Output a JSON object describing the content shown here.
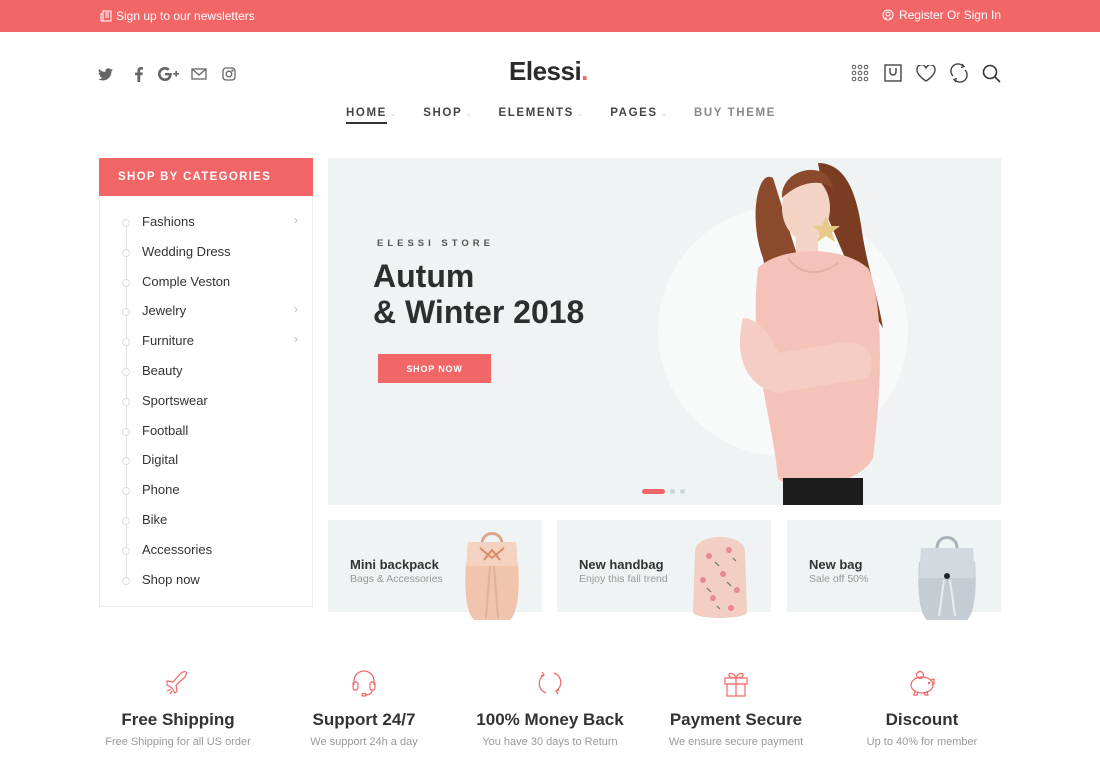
{
  "topbar": {
    "newsletter": "Sign up to our newsletters",
    "account": "Register Or Sign In"
  },
  "brand": {
    "name": "Elessi",
    "dot": ".",
    "accent": "#f26667"
  },
  "social": [
    "twitter-icon",
    "facebook-icon",
    "google-plus-icon",
    "mail-icon",
    "instagram-icon"
  ],
  "tools": [
    "grid-menu-icon",
    "shopping-bag-icon",
    "heart-icon",
    "compare-icon",
    "search-icon"
  ],
  "nav": [
    {
      "label": "HOME",
      "has_dropdown": true,
      "active": true
    },
    {
      "label": "SHOP",
      "has_dropdown": true
    },
    {
      "label": "ELEMENTS",
      "has_dropdown": true
    },
    {
      "label": "PAGES",
      "has_dropdown": true
    },
    {
      "label": "BUY THEME",
      "has_dropdown": false
    }
  ],
  "categories": {
    "heading": "SHOP BY CATEGORIES",
    "items": [
      {
        "label": "Fashions",
        "has_sub": true
      },
      {
        "label": "Wedding Dress",
        "has_sub": false
      },
      {
        "label": "Comple Veston",
        "has_sub": false
      },
      {
        "label": "Jewelry",
        "has_sub": true
      },
      {
        "label": "Furniture",
        "has_sub": true
      },
      {
        "label": "Beauty",
        "has_sub": false
      },
      {
        "label": "Sportswear",
        "has_sub": false
      },
      {
        "label": "Football",
        "has_sub": false
      },
      {
        "label": "Digital",
        "has_sub": false
      },
      {
        "label": "Phone",
        "has_sub": false
      },
      {
        "label": "Bike",
        "has_sub": false
      },
      {
        "label": "Accessories",
        "has_sub": false
      },
      {
        "label": "Shop now",
        "has_sub": false
      }
    ]
  },
  "hero": {
    "eyebrow": "ELESSI STORE",
    "title_line1": "Autum",
    "title_line2": "& Winter 2018",
    "cta": "SHOP NOW",
    "slides_total": 3,
    "active_slide": 1
  },
  "banners": [
    {
      "title": "Mini backpack",
      "desc": "Bags & Accessories"
    },
    {
      "title": "New handbag",
      "desc": "Enjoy this fall trend"
    },
    {
      "title": "New bag",
      "desc": "Sale off 50%"
    }
  ],
  "features": [
    {
      "icon": "airplane-icon",
      "title": "Free Shipping",
      "desc": "Free Shipping for all US order"
    },
    {
      "icon": "headset-icon",
      "title": "Support 24/7",
      "desc": "We support 24h a day"
    },
    {
      "icon": "refresh-icon",
      "title": "100% Money Back",
      "desc": "You have 30 days to Return"
    },
    {
      "icon": "gift-icon",
      "title": "Payment Secure",
      "desc": "We ensure secure payment"
    },
    {
      "icon": "piggy-bank-icon",
      "title": "Discount",
      "desc": "Up to 40% for member"
    }
  ]
}
